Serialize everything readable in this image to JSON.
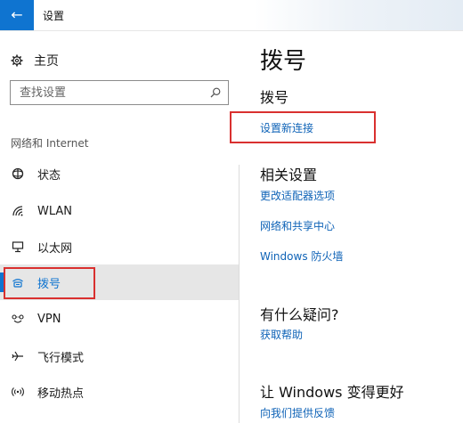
{
  "window": {
    "title": "设置",
    "back_icon": "←"
  },
  "sidebar": {
    "home_label": "主页",
    "search_placeholder": "查找设置",
    "section_label": "网络和 Internet",
    "items": [
      {
        "label": "状态",
        "icon": "status-icon",
        "active": false
      },
      {
        "label": "WLAN",
        "icon": "wlan-icon",
        "active": false
      },
      {
        "label": "以太网",
        "icon": "ethernet-icon",
        "active": false
      },
      {
        "label": "拨号",
        "icon": "dialup-icon",
        "active": true
      },
      {
        "label": "VPN",
        "icon": "vpn-icon",
        "active": false
      },
      {
        "label": "飞行模式",
        "icon": "airplane-icon",
        "active": false
      },
      {
        "label": "移动热点",
        "icon": "hotspot-icon",
        "active": false
      }
    ]
  },
  "main": {
    "page_title": "拨号",
    "section_title": "拨号",
    "setup_link": "设置新连接",
    "related": {
      "title": "相关设置",
      "links": [
        "更改适配器选项",
        "网络和共享中心",
        "Windows 防火墙"
      ]
    },
    "question": {
      "title": "有什么疑问?",
      "link": "获取帮助"
    },
    "feedback": {
      "title": "让 Windows 变得更好",
      "link": "向我们提供反馈"
    }
  },
  "colors": {
    "accent": "#0f74d0",
    "link": "#0f63b7",
    "highlight_box": "#d9302f",
    "active_bg": "#e6e6e6"
  }
}
